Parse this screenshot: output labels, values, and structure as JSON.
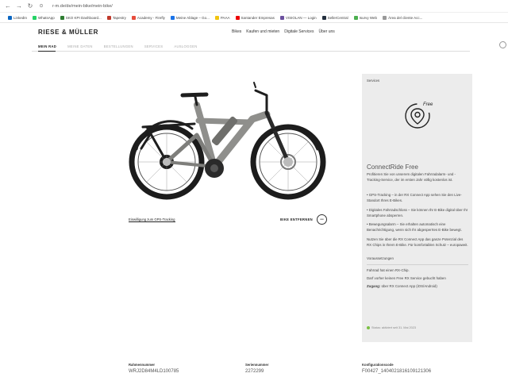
{
  "browser": {
    "url": "r-m.de/de/mein-bike/mein-bike/",
    "back_icon": "back-arrow-icon",
    "forward_icon": "forward-arrow-icon",
    "reload_icon": "reload-icon"
  },
  "bookmarks": [
    {
      "label": "LinkedIn",
      "color": "#0a66c2"
    },
    {
      "label": "WhatsApp",
      "color": "#25d366"
    },
    {
      "label": "SKO KPI Dashboard...",
      "color": "#2e7d32"
    },
    {
      "label": "Tapestry",
      "color": "#c0392b"
    },
    {
      "label": "Academy - Firefly",
      "color": "#e74c3c"
    },
    {
      "label": "Meine Ablage – Go...",
      "color": "#1a73e8"
    },
    {
      "label": "PAAA",
      "color": "#f1c40f"
    },
    {
      "label": "Santander Empresas",
      "color": "#ec0000"
    },
    {
      "label": "VISIOLAN — Login",
      "color": "#6b4f9e"
    },
    {
      "label": "SellerCentral",
      "color": "#232f3e"
    },
    {
      "label": "Isurvy Web",
      "color": "#4caf50"
    },
    {
      "label": "Área del cliente Acc...",
      "color": "#999999"
    }
  ],
  "site": {
    "logo": "RIESE & MÜLLER",
    "nav": [
      "Bikes",
      "Kaufen und mieten",
      "Digitale Services",
      "Über uns"
    ],
    "subnav": [
      "MEIN RAD",
      "MEINE DATEN",
      "BESTELLUNGEN",
      "SERVICES",
      "AUSLOGGEN"
    ]
  },
  "bike": {
    "consent_link": "Einwilligung zum GPS-Tracking",
    "remove_label": "BIKE ENTFERNEN",
    "remove_icon": "minus-icon",
    "frame_color": "#8f8f8c"
  },
  "service_card": {
    "label": "Services",
    "icon": "map-pin-refresh-icon",
    "icon_badge": "Free",
    "title": "ConnectRide Free",
    "intro": "Profitieren Sie von unserem digitalen Fahrradalarm- und -Tracking-Service, der im ersten Jahr völlig kostenlos ist.",
    "bullets": [
      "• GPS-Tracking – in der RX Connect App sehen Sie den Live-Standort Ihres E-Bikes.",
      "• Digitales Fahrradschloss – Sie können Ihr E-Bike digital über Ihr Smartphone absperren.",
      "• Bewegungsalarm – Sie erhalten automatisch eine Benachrichtigung, wenn sich Ihr abgesperrtes E-Bike bewegt."
    ],
    "outro": "Nutzen Sie über die RX Connect App das ganze Potenzial des RX Chips in Ihrem E-Bike. Für komfortablen Schutz – europaweit.",
    "requirements_title": "Voraussetzungen",
    "requirements": [
      "Fahrrad hat einen RX-Chip.",
      "Darf vorher keinen Free RX Service gebucht haben"
    ],
    "access_label": "Zugang:",
    "access_text": " über RX Connect App (iOS/Android)",
    "status": "Status: aktiviert seit 31. Mai 2023",
    "status_color": "#7bc043"
  },
  "info": [
    {
      "label": "Rahmennummer",
      "value": "WRJ2D84M4LD100785"
    },
    {
      "label": "Seriennummer",
      "value": "2272299"
    },
    {
      "label": "Konfigurationscode",
      "value": "F00427_1404021816109121306"
    }
  ]
}
